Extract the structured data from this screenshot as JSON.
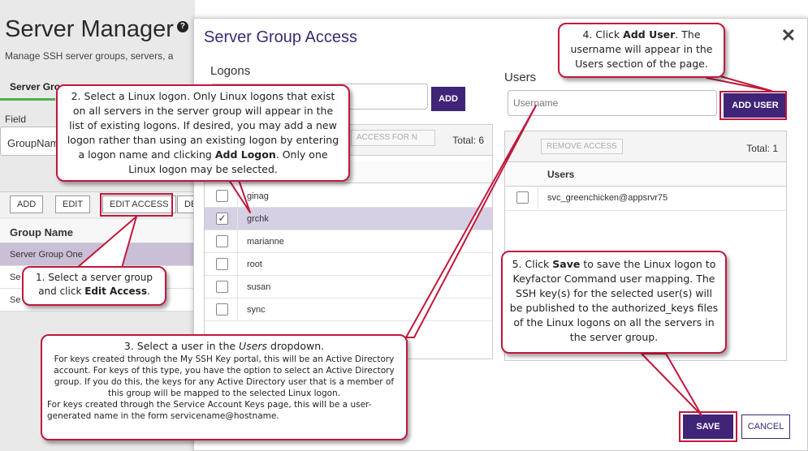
{
  "background": {
    "title": "Server Manager",
    "help_icon": "?",
    "subtitle": "Manage SSH server groups, servers, a",
    "tab_label": "Server Gro",
    "field_label": "Field",
    "field_value": "GroupNam",
    "buttons": {
      "add": "ADD",
      "edit": "EDIT",
      "edit_access": "EDIT ACCESS",
      "de": "DE"
    },
    "grid_header": "Group Name",
    "rows": [
      "Server Group One",
      "Se",
      "Se"
    ]
  },
  "modal": {
    "title": "Server Group Access",
    "close": "✕",
    "logons": {
      "label": "Logons",
      "add_button": "ADD",
      "access_button": "ACCESS FOR N",
      "total": "Total: 6",
      "items": [
        {
          "name": "ginag",
          "checked": false
        },
        {
          "name": "grchk",
          "checked": true
        },
        {
          "name": "marianne",
          "checked": false
        },
        {
          "name": "root",
          "checked": false
        },
        {
          "name": "susan",
          "checked": false
        },
        {
          "name": "sync",
          "checked": false
        }
      ]
    },
    "users": {
      "label": "Users",
      "placeholder": "Username",
      "add_button": "ADD USER",
      "remove_button": "REMOVE ACCESS",
      "total": "Total: 1",
      "column": "Users",
      "items": [
        "svc_greenchicken@appsrvr75"
      ]
    },
    "save_button": "SAVE",
    "cancel_button": "CANCEL"
  },
  "callouts": {
    "c1": {
      "t1": "1. Select a server group",
      "t2": "and click ",
      "b": "Edit Access",
      "t3": "."
    },
    "c2": {
      "t1": "2. Select a Linux logon. Only Linux logons that exist on all servers in the server group will appear in the list of existing logons. If desired, you may add a new logon rather than using an existing logon by entering a logon name and clicking ",
      "b": "Add Logon",
      "t2": ". Only one Linux logon may be selected."
    },
    "c3": {
      "t1": "3. Select a  user in the ",
      "i": "Users",
      "t2": " dropdown.",
      "l2": "For keys created through the My SSH Key portal, this will be an Active Directory account. For keys of this type, you have the option to select an Active Directory group. If you do this, the keys for any Active Directory user that is a member of this group will be mapped to the selected Linux logon.",
      "l3": "For keys created through the Service Account Keys page, this will be a user-generated name in the form servicename@hostname."
    },
    "c4": {
      "t1": "4. Click ",
      "b": "Add User",
      "t2": ". The username will appear in the Users section of the page."
    },
    "c5": {
      "t1": "5. Click ",
      "b": "Save",
      "t2": " to save the Linux logon to Keyfactor Command user mapping. The SSH key(s) for the selected user(s) will be published to the authorized_keys files of the Linux logons on all the servers in the server group."
    }
  }
}
